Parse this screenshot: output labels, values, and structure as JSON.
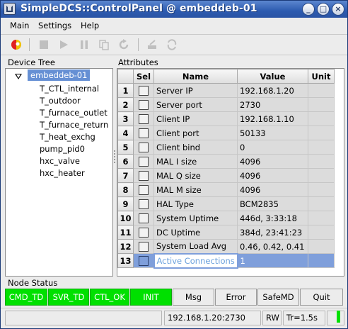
{
  "window": {
    "title": "SimpleDCS::ControlPanel @ embeddeb-01"
  },
  "titlebar_buttons": [
    "_",
    "□",
    "×"
  ],
  "menu": {
    "items": [
      "Main",
      "Settings",
      "Help"
    ]
  },
  "toolbar": {
    "icons": [
      "connect-icon",
      "stop-icon",
      "play-icon",
      "pause-icon",
      "copy-icon",
      "refresh-icon",
      "edit-icon",
      "reload-icon"
    ]
  },
  "device_tree": {
    "label": "Device Tree",
    "root": "embeddeb-01",
    "children": [
      "T_CTL_internal",
      "T_outdoor",
      "T_furnace_outlet",
      "T_furnace_return",
      "T_heat_exchg",
      "pump_pid0",
      "hxc_valve",
      "hxc_heater"
    ]
  },
  "attributes": {
    "label": "Attributes",
    "columns": [
      "Sel",
      "Name",
      "Value",
      "Unit"
    ],
    "rows": [
      {
        "num": "1",
        "name": "Server IP",
        "value": "192.168.1.20",
        "unit": ""
      },
      {
        "num": "2",
        "name": "Server port",
        "value": "2730",
        "unit": ""
      },
      {
        "num": "3",
        "name": "Client IP",
        "value": "192.168.1.10",
        "unit": ""
      },
      {
        "num": "4",
        "name": "Client port",
        "value": "50133",
        "unit": ""
      },
      {
        "num": "5",
        "name": "Client bind",
        "value": "0",
        "unit": ""
      },
      {
        "num": "6",
        "name": "MAL I size",
        "value": "4096",
        "unit": ""
      },
      {
        "num": "7",
        "name": "MAL Q size",
        "value": "4096",
        "unit": ""
      },
      {
        "num": "8",
        "name": "MAL M size",
        "value": "4096",
        "unit": ""
      },
      {
        "num": "9",
        "name": "HAL Type",
        "value": "BCM2835",
        "unit": ""
      },
      {
        "num": "10",
        "name": "System Uptime",
        "value": "446d, 3:33:18",
        "unit": ""
      },
      {
        "num": "11",
        "name": "DC Uptime",
        "value": "384d, 23:41:23",
        "unit": ""
      },
      {
        "num": "12",
        "name": "System Load Avg",
        "value": "0.46, 0.42, 0.41",
        "unit": ""
      },
      {
        "num": "13",
        "name": "Active Connections",
        "value": "1",
        "unit": ""
      }
    ],
    "selected_row": "13"
  },
  "node_status": {
    "label": "Node Status",
    "buttons": [
      "CMD_TD",
      "SVR_TD",
      "CTL_OK",
      "INIT",
      "Msg",
      "Error",
      "SafeMD",
      "Quit"
    ]
  },
  "bottom_bar": {
    "address": "192.168.1.20:2730",
    "mode": "RW",
    "rate": "Tr=1.5s"
  },
  "colors": {
    "status_green": "#00e000",
    "selection_blue": "#7f9fdb",
    "title_blue": "#2d5bb0"
  }
}
